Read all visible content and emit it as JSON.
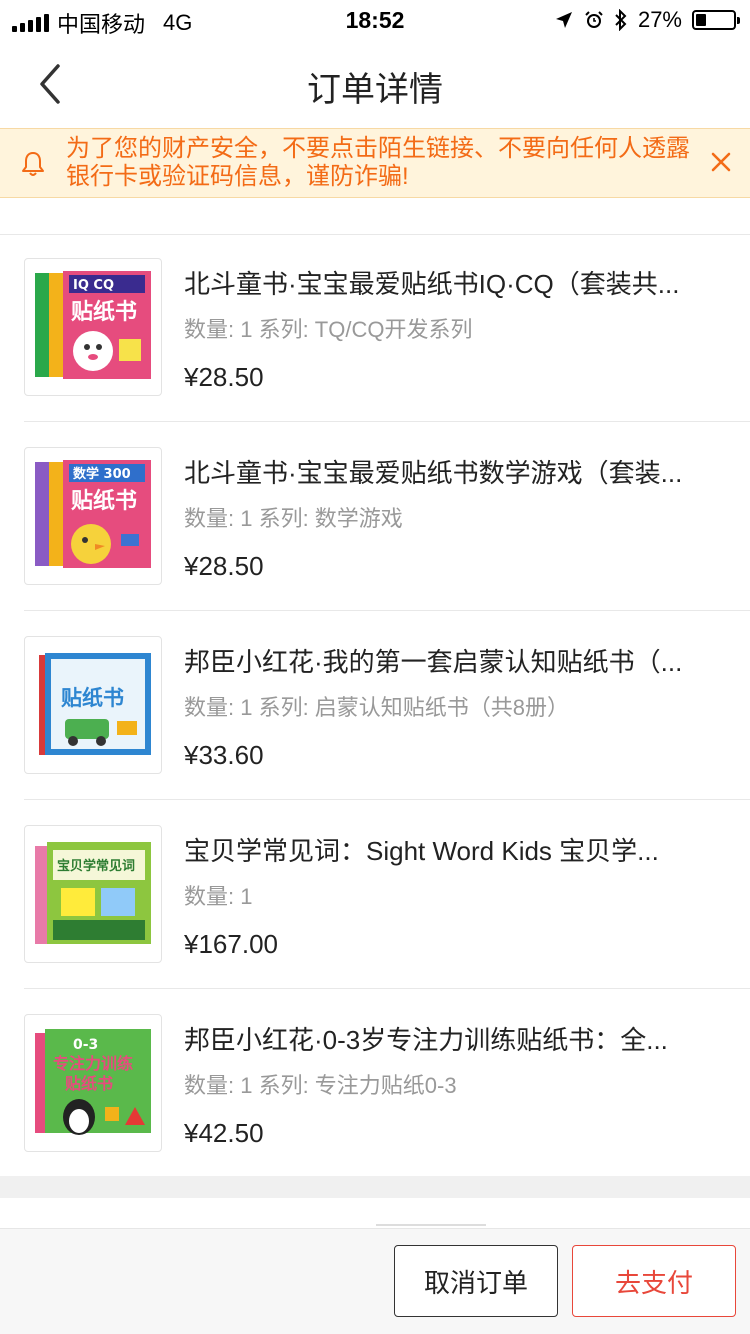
{
  "status_bar": {
    "carrier": "中国移动",
    "network": "4G",
    "time": "18:52",
    "battery": "27%"
  },
  "nav": {
    "title": "订单详情"
  },
  "notice": {
    "text": "为了您的财产安全，不要点击陌生链接、不要向任何人透露银行卡或验证码信息，谨防诈骗!"
  },
  "items": [
    {
      "title": "北斗童书·宝宝最爱贴纸书IQ·CQ（套装共...",
      "meta": "数量: 1 系列: TQ/CQ开发系列",
      "price": "¥28.50",
      "cover_color": "#e64c7e"
    },
    {
      "title": "北斗童书·宝宝最爱贴纸书数学游戏（套装...",
      "meta": "数量: 1 系列: 数学游戏",
      "price": "¥28.50",
      "cover_color": "#e64c7e"
    },
    {
      "title": "邦臣小红花·我的第一套启蒙认知贴纸书（...",
      "meta": "数量: 1 系列: 启蒙认知贴纸书（共8册）",
      "price": "¥33.60",
      "cover_color": "#2e86d1"
    },
    {
      "title": "宝贝学常见词：Sight Word Kids 宝贝学...",
      "meta": "数量: 1",
      "price": "¥167.00",
      "cover_color": "#8dc63f"
    },
    {
      "title": "邦臣小红花·0-3岁专注力训练贴纸书：全...",
      "meta": "数量: 1 系列: 专注力贴纸0-3",
      "price": "¥42.50",
      "cover_color": "#5ab94b"
    }
  ],
  "footer": {
    "cancel_label": "取消订单",
    "pay_label": "去支付"
  },
  "colors": {
    "accent": "#e8473a",
    "notice_text": "#f36b16"
  }
}
